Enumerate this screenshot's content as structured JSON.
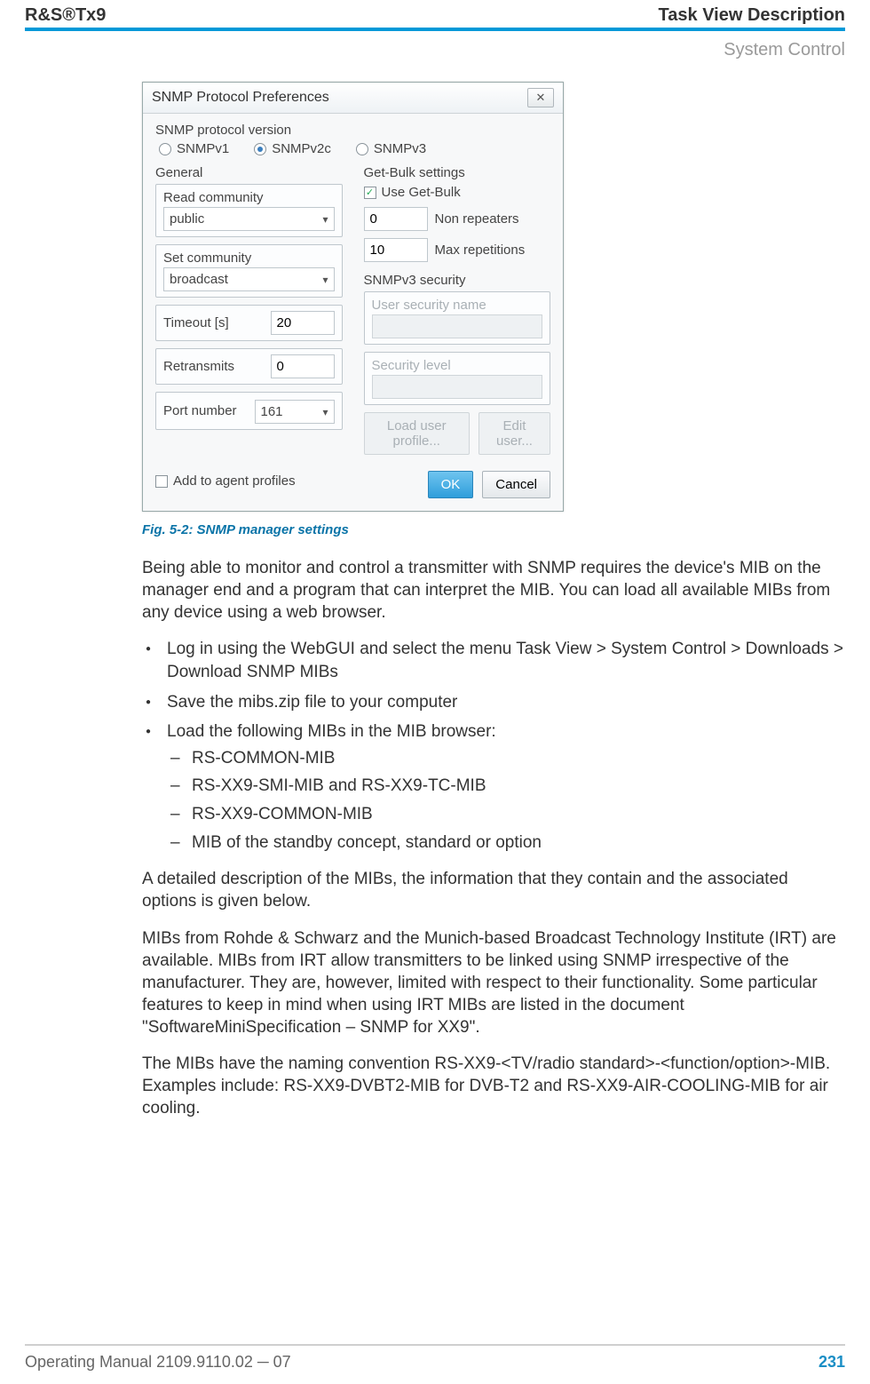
{
  "header": {
    "product": "R&S®Tx9",
    "chapter_title": "Task View Description",
    "section": "System Control"
  },
  "dialog": {
    "title": "SNMP Protocol Preferences",
    "close_glyph": "✕",
    "version_label": "SNMP protocol version",
    "radios": {
      "v1": "SNMPv1",
      "v2c": "SNMPv2c",
      "v3": "SNMPv3",
      "selected": "v2c"
    },
    "general_label": "General",
    "read_label": "Read community",
    "read_value": "public",
    "set_label": "Set community",
    "set_value": "broadcast",
    "timeout_label": "Timeout [s]",
    "timeout_value": "20",
    "retrans_label": "Retransmits",
    "retrans_value": "0",
    "port_label": "Port number",
    "port_value": "161",
    "getbulk_label": "Get-Bulk settings",
    "use_getbulk_label": "Use Get-Bulk",
    "use_getbulk_checked": true,
    "nonrep_value": "0",
    "nonrep_label": "Non repeaters",
    "maxrep_value": "10",
    "maxrep_label": "Max repetitions",
    "sec_label": "SNMPv3 security",
    "user_sec_label": "User security name",
    "sec_level_label": "Security level",
    "load_btn": "Load user profile...",
    "edit_btn": "Edit user...",
    "add_profiles_label": "Add to agent profiles",
    "ok": "OK",
    "cancel": "Cancel"
  },
  "caption": "Fig. 5-2: SNMP manager settings",
  "para1": "Being able to monitor and control a transmitter with SNMP requires the device's MIB on the manager end and a program that can interpret the MIB. You can load all available MIBs from any device using a web browser.",
  "bul": {
    "b1": "Log in using the WebGUI and select the menu Task View > System Control > Downloads > Download SNMP MIBs",
    "b2": "Save the mibs.zip file to your computer",
    "b3": "Load the following MIBs in the MIB browser:",
    "d1": "RS-COMMON-MIB",
    "d2": "RS-XX9-SMI-MIB and RS-XX9-TC-MIB",
    "d3": "RS-XX9-COMMON-MIB",
    "d4": "MIB of the standby concept, standard or option"
  },
  "para2": "A detailed description of the MIBs, the information that they contain and the associated options is given below.",
  "para3": "MIBs from Rohde & Schwarz and the Munich-based Broadcast Technology Institute (IRT) are available. MIBs from IRT allow transmitters to be linked using SNMP irrespective of the manufacturer. They are, however, limited with respect to their functionality. Some particular features to keep in mind when using IRT MIBs are listed in the document \"SoftwareMiniSpecification – SNMP for XX9\".",
  "para4": "The MIBs have the naming convention RS-XX9-<TV/radio standard>-<function/option>-MIB. Examples include: RS-XX9-DVBT2-MIB for DVB-T2 and RS-XX9-AIR-COOLING-MIB for air cooling.",
  "footer": {
    "manual": "Operating Manual 2109.9110.02 ─ 07",
    "page": "231"
  }
}
